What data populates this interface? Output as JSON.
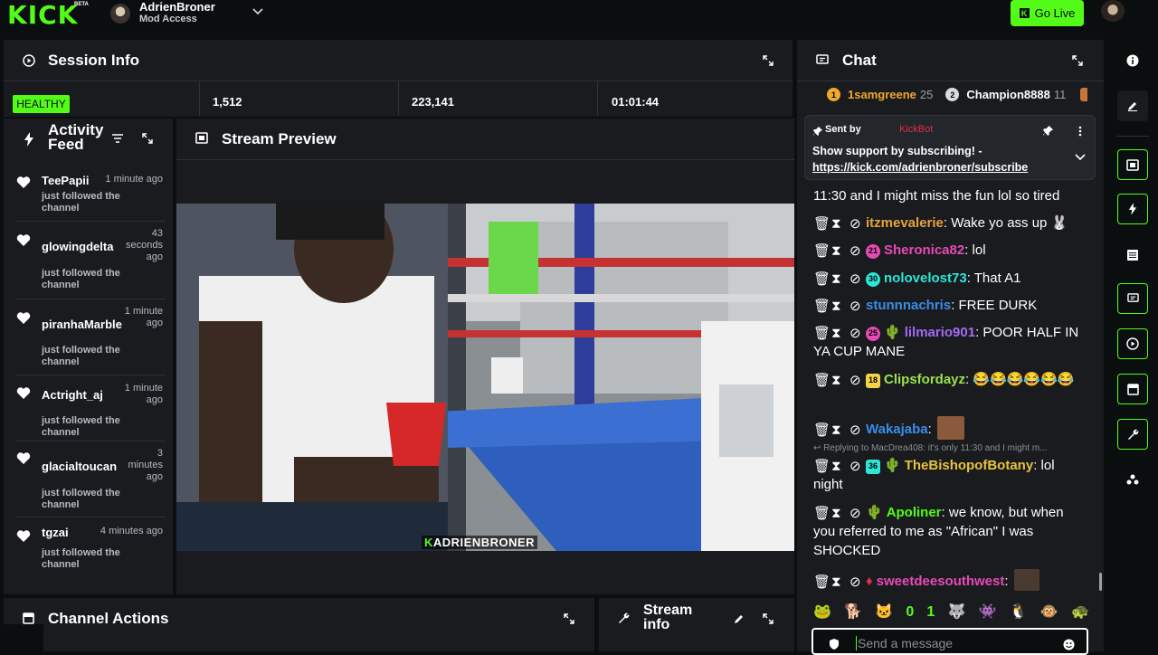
{
  "topbar": {
    "logo": "KICK",
    "beta": "BETA",
    "username": "AdrienBroner",
    "role": "Mod Access",
    "go_live": "Go Live"
  },
  "session": {
    "title": "Session Info",
    "health": "HEALTHY",
    "stats": [
      "1,512",
      "223,141",
      "01:01:44"
    ]
  },
  "activity": {
    "title_line1": "Activity",
    "title_line2": "Feed",
    "items": [
      {
        "name": "TeePapii",
        "time": "1 minute ago",
        "desc": "just followed the channel"
      },
      {
        "name": "glowingdelta",
        "time": "43 seconds ago",
        "desc": "just followed the channel"
      },
      {
        "name": "piranhaMarble",
        "time": "1 minute ago",
        "desc": "just followed the channel"
      },
      {
        "name": "Actright_aj",
        "time": "1 minute ago",
        "desc": "just followed the channel"
      },
      {
        "name": "glacialtoucan",
        "time": "3 minutes ago",
        "desc": "just followed the channel"
      },
      {
        "name": "tgzai",
        "time": "4 minutes ago",
        "desc": "just followed the channel"
      }
    ]
  },
  "preview": {
    "title": "Stream Preview",
    "watermark": "ADRIENBRONER"
  },
  "channel_actions": {
    "title": "Channel Actions"
  },
  "stream_info": {
    "title_line1": "Stream",
    "title_line2": "info"
  },
  "chat": {
    "title": "Chat",
    "leaderboard": [
      {
        "rank": "1",
        "name": "1samgreene",
        "count": "25"
      },
      {
        "rank": "2",
        "name": "Champion8888",
        "count": "11"
      }
    ],
    "pinned": {
      "sent_by_label": "Sent by",
      "sender": "KickBot",
      "message": "Show support by subscribing! -",
      "link": "https://kick.com/adrienbroner/subscribe"
    },
    "partial_line": "11:30 and I might miss the fun lol so tired",
    "messages": [
      {
        "badge": "",
        "name": "itzmevalerie",
        "color": "#e8a33a",
        "text": ": Wake yo ass up 🐰"
      },
      {
        "badge": "21",
        "badge_color": "#e64bb5",
        "name": "Sheronica82",
        "color": "#e64bb5",
        "text": ": lol"
      },
      {
        "badge": "30",
        "badge_color": "#2ee6d6",
        "name": "nolovelost73",
        "color": "#2ee6d6",
        "text": ": That A1"
      },
      {
        "badge": "",
        "name": "stunnnachris",
        "color": "#3b8de8",
        "text": ": FREE DURK"
      },
      {
        "badge": "25",
        "badge_color": "#e64bb5",
        "name": "lilmario901",
        "color": "#a46bf0",
        "text": ": POOR HALF IN YA CUP MANE"
      },
      {
        "badge": "18",
        "badge_color": "#f3d347",
        "name": "Clipsfordayz",
        "color": "#9be34a",
        "text": ": 😂😂😂😂😂😂"
      },
      {
        "badge": "",
        "name": "Wakajaba",
        "color": "#3b8de8",
        "text": ":"
      },
      {
        "badge": "36",
        "badge_color": "#2ee6d6",
        "name": "TheBishopofBotany",
        "color": "#e8c33a",
        "text": ": lol night",
        "reply": "Replying to MacDrea408: it's only 11:30 and I might m..."
      },
      {
        "badge": "",
        "name": "Apoliner",
        "color": "#53fc18",
        "text": ": we know, but when you referred to me as \"African\" I was SHOCKED"
      },
      {
        "badge": "",
        "name": "sweetdeesouthwest",
        "color": "#e64bb5",
        "text": ":"
      }
    ],
    "emote_bar": [
      "🐸",
      "🐕",
      "🐱",
      "0",
      "1",
      "🐺",
      "👾",
      "🐧",
      "🐵",
      "🐢"
    ],
    "send_placeholder": "Send a message"
  },
  "colors": {
    "accent": "#53fc18",
    "panel": "#191b1f",
    "background": "#0b0e0f"
  }
}
